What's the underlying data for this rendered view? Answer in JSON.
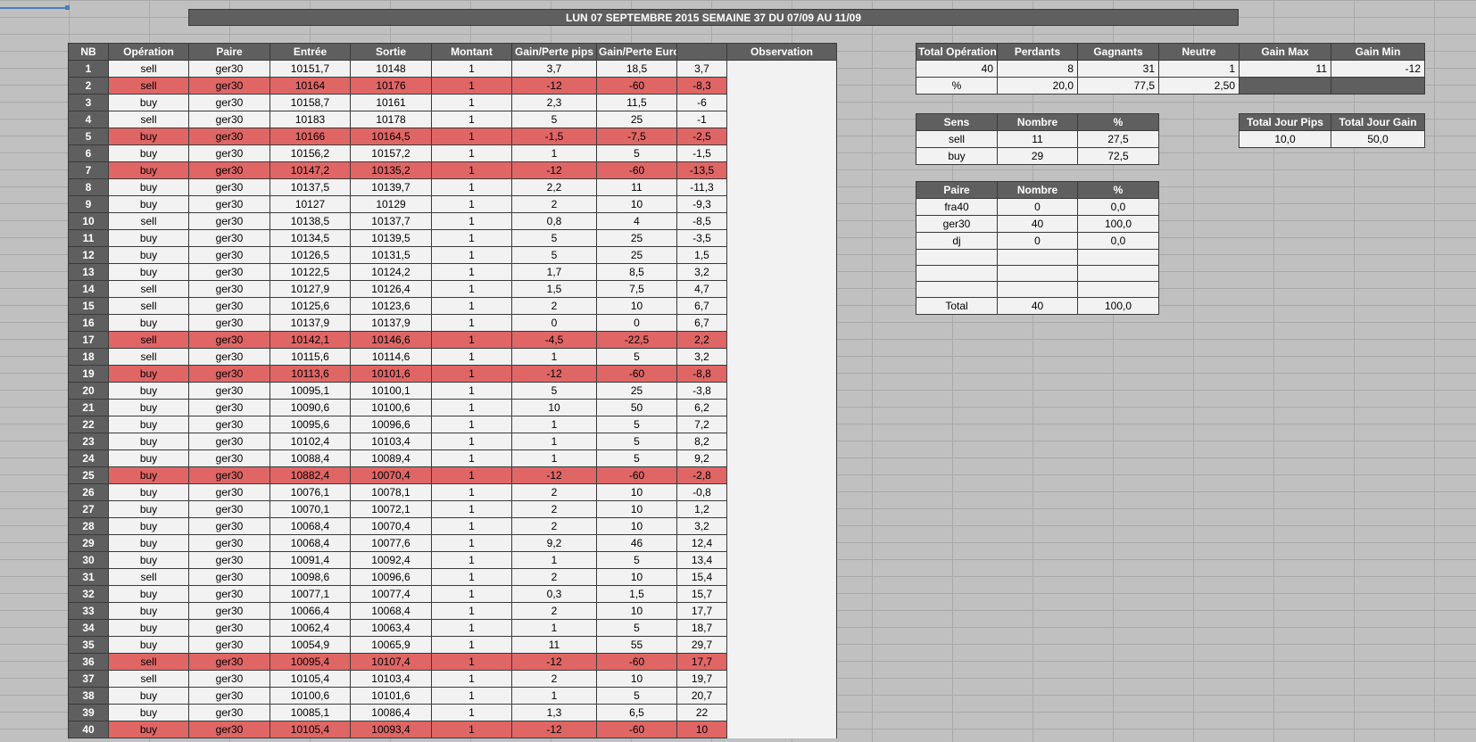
{
  "title": "LUN 07 SEPTEMBRE 2015 SEMAINE 37 DU 07/09 AU 11/09",
  "main_table": {
    "headers": [
      "NB",
      "Opération",
      "Paire",
      "Entrée",
      "Sortie",
      "Montant",
      "Gain/Perte pips",
      "Gain/Perte Euro",
      "",
      "Observation"
    ],
    "rows": [
      {
        "nb": "1",
        "op": "sell",
        "paire": "ger30",
        "entree": "10151,7",
        "sortie": "10148",
        "montant": "1",
        "pips": "3,7",
        "euro": "18,5",
        "cumul": "3,7",
        "loss": false
      },
      {
        "nb": "2",
        "op": "sell",
        "paire": "ger30",
        "entree": "10164",
        "sortie": "10176",
        "montant": "1",
        "pips": "-12",
        "euro": "-60",
        "cumul": "-8,3",
        "loss": true
      },
      {
        "nb": "3",
        "op": "buy",
        "paire": "ger30",
        "entree": "10158,7",
        "sortie": "10161",
        "montant": "1",
        "pips": "2,3",
        "euro": "11,5",
        "cumul": "-6",
        "loss": false
      },
      {
        "nb": "4",
        "op": "sell",
        "paire": "ger30",
        "entree": "10183",
        "sortie": "10178",
        "montant": "1",
        "pips": "5",
        "euro": "25",
        "cumul": "-1",
        "loss": false
      },
      {
        "nb": "5",
        "op": "buy",
        "paire": "ger30",
        "entree": "10166",
        "sortie": "10164,5",
        "montant": "1",
        "pips": "-1,5",
        "euro": "-7,5",
        "cumul": "-2,5",
        "loss": true
      },
      {
        "nb": "6",
        "op": "buy",
        "paire": "ger30",
        "entree": "10156,2",
        "sortie": "10157,2",
        "montant": "1",
        "pips": "1",
        "euro": "5",
        "cumul": "-1,5",
        "loss": false
      },
      {
        "nb": "7",
        "op": "buy",
        "paire": "ger30",
        "entree": "10147,2",
        "sortie": "10135,2",
        "montant": "1",
        "pips": "-12",
        "euro": "-60",
        "cumul": "-13,5",
        "loss": true
      },
      {
        "nb": "8",
        "op": "buy",
        "paire": "ger30",
        "entree": "10137,5",
        "sortie": "10139,7",
        "montant": "1",
        "pips": "2,2",
        "euro": "11",
        "cumul": "-11,3",
        "loss": false
      },
      {
        "nb": "9",
        "op": "buy",
        "paire": "ger30",
        "entree": "10127",
        "sortie": "10129",
        "montant": "1",
        "pips": "2",
        "euro": "10",
        "cumul": "-9,3",
        "loss": false
      },
      {
        "nb": "10",
        "op": "sell",
        "paire": "ger30",
        "entree": "10138,5",
        "sortie": "10137,7",
        "montant": "1",
        "pips": "0,8",
        "euro": "4",
        "cumul": "-8,5",
        "loss": false
      },
      {
        "nb": "11",
        "op": "buy",
        "paire": "ger30",
        "entree": "10134,5",
        "sortie": "10139,5",
        "montant": "1",
        "pips": "5",
        "euro": "25",
        "cumul": "-3,5",
        "loss": false
      },
      {
        "nb": "12",
        "op": "buy",
        "paire": "ger30",
        "entree": "10126,5",
        "sortie": "10131,5",
        "montant": "1",
        "pips": "5",
        "euro": "25",
        "cumul": "1,5",
        "loss": false
      },
      {
        "nb": "13",
        "op": "buy",
        "paire": "ger30",
        "entree": "10122,5",
        "sortie": "10124,2",
        "montant": "1",
        "pips": "1,7",
        "euro": "8,5",
        "cumul": "3,2",
        "loss": false
      },
      {
        "nb": "14",
        "op": "sell",
        "paire": "ger30",
        "entree": "10127,9",
        "sortie": "10126,4",
        "montant": "1",
        "pips": "1,5",
        "euro": "7,5",
        "cumul": "4,7",
        "loss": false
      },
      {
        "nb": "15",
        "op": "sell",
        "paire": "ger30",
        "entree": "10125,6",
        "sortie": "10123,6",
        "montant": "1",
        "pips": "2",
        "euro": "10",
        "cumul": "6,7",
        "loss": false
      },
      {
        "nb": "16",
        "op": "buy",
        "paire": "ger30",
        "entree": "10137,9",
        "sortie": "10137,9",
        "montant": "1",
        "pips": "0",
        "euro": "0",
        "cumul": "6,7",
        "loss": false
      },
      {
        "nb": "17",
        "op": "sell",
        "paire": "ger30",
        "entree": "10142,1",
        "sortie": "10146,6",
        "montant": "1",
        "pips": "-4,5",
        "euro": "-22,5",
        "cumul": "2,2",
        "loss": true
      },
      {
        "nb": "18",
        "op": "sell",
        "paire": "ger30",
        "entree": "10115,6",
        "sortie": "10114,6",
        "montant": "1",
        "pips": "1",
        "euro": "5",
        "cumul": "3,2",
        "loss": false
      },
      {
        "nb": "19",
        "op": "buy",
        "paire": "ger30",
        "entree": "10113,6",
        "sortie": "10101,6",
        "montant": "1",
        "pips": "-12",
        "euro": "-60",
        "cumul": "-8,8",
        "loss": true
      },
      {
        "nb": "20",
        "op": "buy",
        "paire": "ger30",
        "entree": "10095,1",
        "sortie": "10100,1",
        "montant": "1",
        "pips": "5",
        "euro": "25",
        "cumul": "-3,8",
        "loss": false
      },
      {
        "nb": "21",
        "op": "buy",
        "paire": "ger30",
        "entree": "10090,6",
        "sortie": "10100,6",
        "montant": "1",
        "pips": "10",
        "euro": "50",
        "cumul": "6,2",
        "loss": false
      },
      {
        "nb": "22",
        "op": "buy",
        "paire": "ger30",
        "entree": "10095,6",
        "sortie": "10096,6",
        "montant": "1",
        "pips": "1",
        "euro": "5",
        "cumul": "7,2",
        "loss": false
      },
      {
        "nb": "23",
        "op": "buy",
        "paire": "ger30",
        "entree": "10102,4",
        "sortie": "10103,4",
        "montant": "1",
        "pips": "1",
        "euro": "5",
        "cumul": "8,2",
        "loss": false
      },
      {
        "nb": "24",
        "op": "buy",
        "paire": "ger30",
        "entree": "10088,4",
        "sortie": "10089,4",
        "montant": "1",
        "pips": "1",
        "euro": "5",
        "cumul": "9,2",
        "loss": false
      },
      {
        "nb": "25",
        "op": "buy",
        "paire": "ger30",
        "entree": "10882,4",
        "sortie": "10070,4",
        "montant": "1",
        "pips": "-12",
        "euro": "-60",
        "cumul": "-2,8",
        "loss": true
      },
      {
        "nb": "26",
        "op": "buy",
        "paire": "ger30",
        "entree": "10076,1",
        "sortie": "10078,1",
        "montant": "1",
        "pips": "2",
        "euro": "10",
        "cumul": "-0,8",
        "loss": false
      },
      {
        "nb": "27",
        "op": "buy",
        "paire": "ger30",
        "entree": "10070,1",
        "sortie": "10072,1",
        "montant": "1",
        "pips": "2",
        "euro": "10",
        "cumul": "1,2",
        "loss": false
      },
      {
        "nb": "28",
        "op": "buy",
        "paire": "ger30",
        "entree": "10068,4",
        "sortie": "10070,4",
        "montant": "1",
        "pips": "2",
        "euro": "10",
        "cumul": "3,2",
        "loss": false
      },
      {
        "nb": "29",
        "op": "buy",
        "paire": "ger30",
        "entree": "10068,4",
        "sortie": "10077,6",
        "montant": "1",
        "pips": "9,2",
        "euro": "46",
        "cumul": "12,4",
        "loss": false
      },
      {
        "nb": "30",
        "op": "buy",
        "paire": "ger30",
        "entree": "10091,4",
        "sortie": "10092,4",
        "montant": "1",
        "pips": "1",
        "euro": "5",
        "cumul": "13,4",
        "loss": false
      },
      {
        "nb": "31",
        "op": "sell",
        "paire": "ger30",
        "entree": "10098,6",
        "sortie": "10096,6",
        "montant": "1",
        "pips": "2",
        "euro": "10",
        "cumul": "15,4",
        "loss": false
      },
      {
        "nb": "32",
        "op": "buy",
        "paire": "ger30",
        "entree": "10077,1",
        "sortie": "10077,4",
        "montant": "1",
        "pips": "0,3",
        "euro": "1,5",
        "cumul": "15,7",
        "loss": false
      },
      {
        "nb": "33",
        "op": "buy",
        "paire": "ger30",
        "entree": "10066,4",
        "sortie": "10068,4",
        "montant": "1",
        "pips": "2",
        "euro": "10",
        "cumul": "17,7",
        "loss": false
      },
      {
        "nb": "34",
        "op": "buy",
        "paire": "ger30",
        "entree": "10062,4",
        "sortie": "10063,4",
        "montant": "1",
        "pips": "1",
        "euro": "5",
        "cumul": "18,7",
        "loss": false
      },
      {
        "nb": "35",
        "op": "buy",
        "paire": "ger30",
        "entree": "10054,9",
        "sortie": "10065,9",
        "montant": "1",
        "pips": "11",
        "euro": "55",
        "cumul": "29,7",
        "loss": false
      },
      {
        "nb": "36",
        "op": "sell",
        "paire": "ger30",
        "entree": "10095,4",
        "sortie": "10107,4",
        "montant": "1",
        "pips": "-12",
        "euro": "-60",
        "cumul": "17,7",
        "loss": true
      },
      {
        "nb": "37",
        "op": "sell",
        "paire": "ger30",
        "entree": "10105,4",
        "sortie": "10103,4",
        "montant": "1",
        "pips": "2",
        "euro": "10",
        "cumul": "19,7",
        "loss": false
      },
      {
        "nb": "38",
        "op": "buy",
        "paire": "ger30",
        "entree": "10100,6",
        "sortie": "10101,6",
        "montant": "1",
        "pips": "1",
        "euro": "5",
        "cumul": "20,7",
        "loss": false
      },
      {
        "nb": "39",
        "op": "buy",
        "paire": "ger30",
        "entree": "10085,1",
        "sortie": "10086,4",
        "montant": "1",
        "pips": "1,3",
        "euro": "6,5",
        "cumul": "22",
        "loss": false
      },
      {
        "nb": "40",
        "op": "buy",
        "paire": "ger30",
        "entree": "10105,4",
        "sortie": "10093,4",
        "montant": "1",
        "pips": "-12",
        "euro": "-60",
        "cumul": "10",
        "loss": true
      }
    ]
  },
  "summary": {
    "headers": [
      "Total Opérations",
      "Perdants",
      "Gagnants",
      "Neutre",
      "Gain Max",
      "Gain Min"
    ],
    "values": [
      "40",
      "8",
      "31",
      "1",
      "11",
      "-12"
    ],
    "pct_label": "%",
    "pct_values": [
      "20,0",
      "77,5",
      "2,50"
    ]
  },
  "sens": {
    "headers": [
      "Sens",
      "Nombre",
      "%"
    ],
    "rows": [
      [
        "sell",
        "11",
        "27,5"
      ],
      [
        "buy",
        "29",
        "72,5"
      ]
    ]
  },
  "jour": {
    "headers": [
      "Total Jour Pips",
      "Total Jour Gain"
    ],
    "values": [
      "10,0",
      "50,0"
    ]
  },
  "paire": {
    "headers": [
      "Paire",
      "Nombre",
      "%"
    ],
    "rows": [
      [
        "fra40",
        "0",
        "0,0"
      ],
      [
        "ger30",
        "40",
        "100,0"
      ],
      [
        "dj",
        "0",
        "0,0"
      ],
      [
        "",
        "",
        ""
      ],
      [
        "",
        "",
        ""
      ],
      [
        "",
        "",
        ""
      ]
    ],
    "total": [
      "Total",
      "40",
      "100,0"
    ]
  },
  "colors": {
    "header_bg": "#5f5f5f",
    "loss_row": "#e06666",
    "cell_bg": "#f2f2f2",
    "sheet_bg": "#c0c0c0"
  }
}
